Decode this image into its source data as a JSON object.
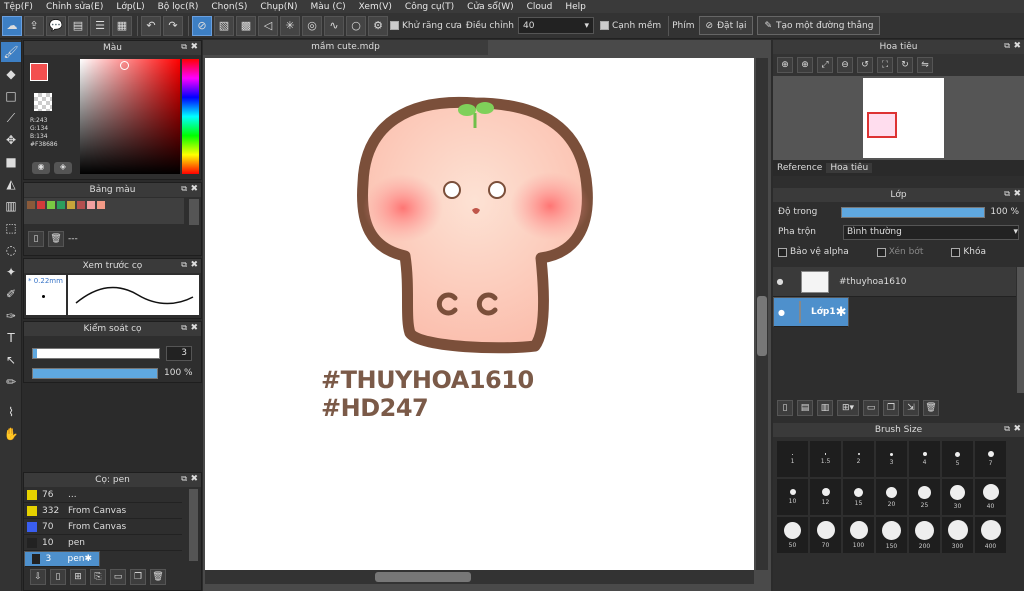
{
  "menu": [
    "Tệp(F)",
    "Chỉnh sửa(E)",
    "Lớp(L)",
    "Bộ lọc(R)",
    "Chọn(S)",
    "Chụp(N)",
    "Màu (C)",
    "Xem(V)",
    "Công cụ(T)",
    "Cửa sổ(W)",
    "Cloud",
    "Help"
  ],
  "toolbar": {
    "antialias_label": "Khử răng cưa",
    "adjust_label": "Điều chỉnh",
    "adjust_value": "40",
    "soft_edge_label": "Cạnh mềm",
    "key_label": "Phím",
    "reset_label": "Đặt lại",
    "straight_line_label": "Tạo một đường thẳng"
  },
  "color_panel": {
    "title": "Màu",
    "r": "R:243",
    "g": "G:134",
    "b": "B:134",
    "hex": "#F38686",
    "fg": "#f34f4f",
    "picker_hue": "#ff0000"
  },
  "palette_panel": {
    "title": "Bảng màu",
    "swatches": [
      "#8a5a3a",
      "#d23b3b",
      "#7ac943",
      "#2c9e5e",
      "#c7a43a",
      "#b44f4f",
      "#f3a0a0",
      "#f39a86"
    ],
    "dash": "---"
  },
  "brush_preview": {
    "title": "Xem trước cọ",
    "size": "* 0.22mm"
  },
  "brush_control": {
    "title": "Kiểm soát cọ",
    "size_value": "3",
    "opacity_value": "100 %"
  },
  "brush_list": {
    "title": "Cọ: pen",
    "items": [
      {
        "size": "76",
        "name": "...",
        "color": "#e6d200"
      },
      {
        "size": "332",
        "name": "From Canvas",
        "color": "#e6d200"
      },
      {
        "size": "70",
        "name": "From Canvas",
        "color": "#3a5ef0"
      },
      {
        "size": "10",
        "name": "pen",
        "color": "#222222"
      },
      {
        "size": "3",
        "name": "pen",
        "color": "#222222"
      }
    ]
  },
  "document": {
    "tab": "mầm cute.mdp",
    "watermark_line1": "#THUYHOA1610",
    "watermark_line2": "#HD247"
  },
  "navigator": {
    "title": "Hoa tiêu",
    "tab_reference": "Reference",
    "tab_navigator": "Hoa tiêu"
  },
  "layers": {
    "title": "Lớp",
    "opacity_label": "Độ trong",
    "opacity_value": "100 %",
    "blend_label": "Pha trộn",
    "blend_value": "Bình thường",
    "protect_alpha": "Bảo vệ alpha",
    "clipping": "Xén bớt",
    "lock": "Khóa",
    "items": [
      {
        "name": "#thuyhoa1610"
      },
      {
        "name": "Lớp1"
      }
    ]
  },
  "brush_size": {
    "title": "Brush Size",
    "sizes": [
      "1",
      "1.5",
      "2",
      "3",
      "4",
      "5",
      "7",
      "10",
      "12",
      "15",
      "20",
      "25",
      "30",
      "40",
      "50",
      "70",
      "100",
      "150",
      "200",
      "300",
      "400"
    ]
  }
}
